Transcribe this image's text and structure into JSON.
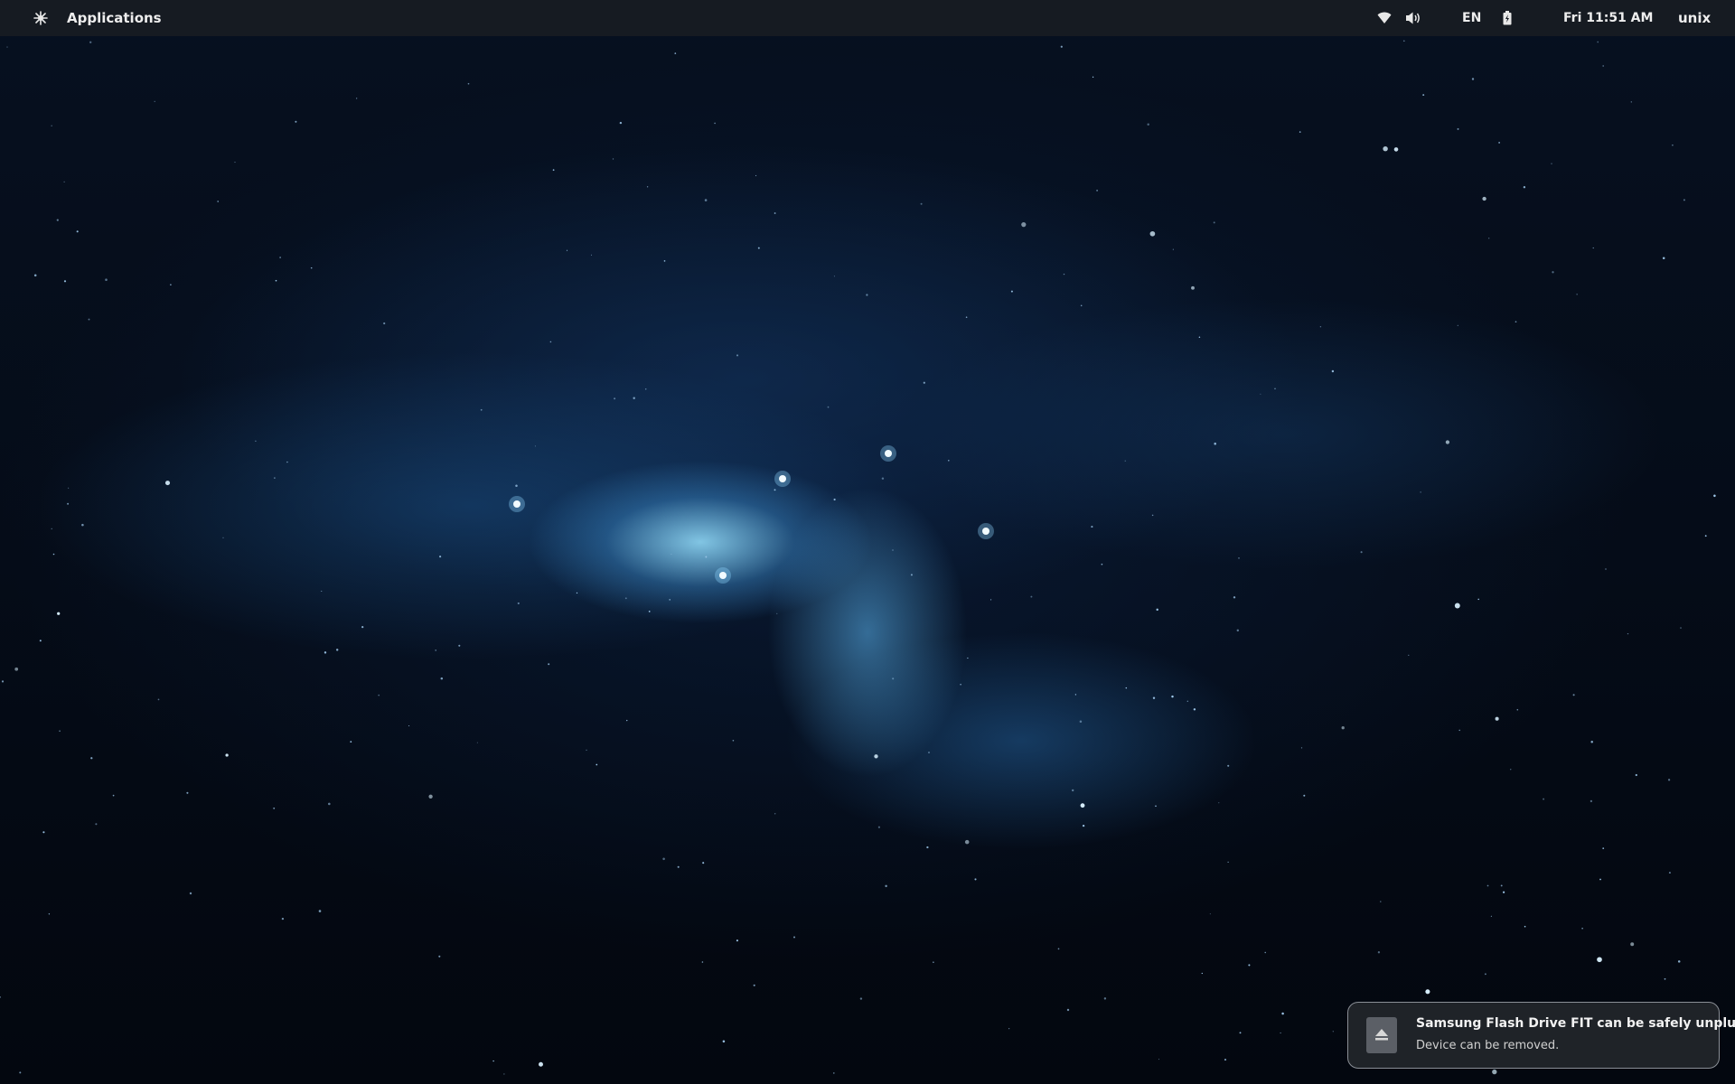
{
  "top_panel": {
    "logo_icon": "system-logo-icon",
    "applications_label": "Applications",
    "indicators": {
      "wifi_icon": "wifi-icon",
      "volume_icon": "volume-icon",
      "keyboard_layout": "EN",
      "battery_icon": "battery-charging-icon"
    },
    "clock": "Fri 11:51 AM",
    "user_name": "unix"
  },
  "notification": {
    "icon": "eject-icon",
    "title": "Samsung Flash Drive FIT can be safely unplugged",
    "body": "Device can be removed."
  },
  "wallpaper": {
    "accent": "#4fb8ff",
    "background": "#050c18"
  }
}
